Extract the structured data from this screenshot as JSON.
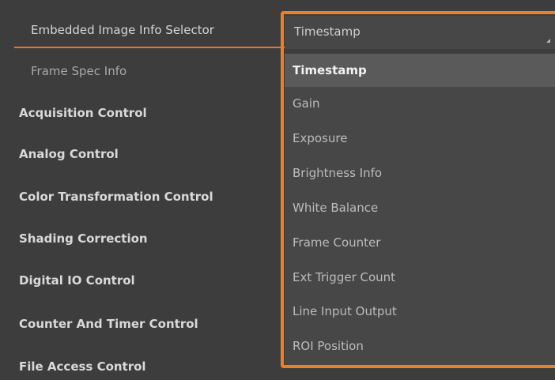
{
  "properties": {
    "selected_label": "Embedded Image Info Selector",
    "frame_spec_label": "Frame Spec Info"
  },
  "categories": [
    "Acquisition Control",
    "Analog Control",
    "Color Transformation Control",
    "Shading Correction",
    "Digital IO Control",
    "Counter And Timer Control",
    "File Access Control"
  ],
  "dropdown": {
    "current_value": "Timestamp",
    "options": [
      "Timestamp",
      "Gain",
      "Exposure",
      "Brightness Info",
      "White Balance",
      "Frame Counter",
      "Ext Trigger Count",
      "Line Input Output",
      "ROI Position"
    ],
    "selected_index": 0
  },
  "colors": {
    "highlight": "#f07f24",
    "background": "#3d3d3d"
  }
}
